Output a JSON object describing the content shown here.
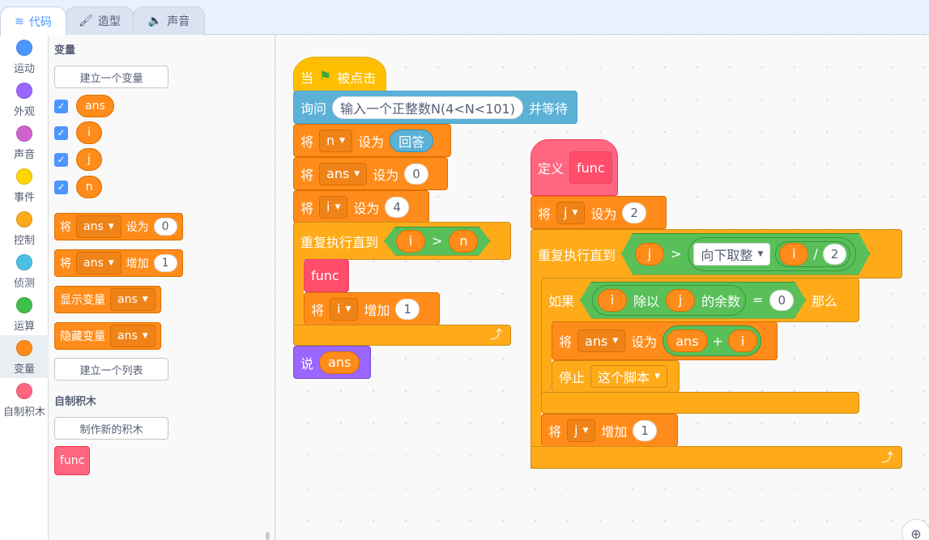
{
  "tabs": [
    {
      "label": "代码",
      "icon": "code-icon"
    },
    {
      "label": "造型",
      "icon": "brush-icon"
    },
    {
      "label": "声音",
      "icon": "speaker-icon"
    }
  ],
  "categories": [
    {
      "label": "运动",
      "color": "#4c97ff"
    },
    {
      "label": "外观",
      "color": "#9966ff"
    },
    {
      "label": "声音",
      "color": "#cf63cf"
    },
    {
      "label": "事件",
      "color": "#ffd500"
    },
    {
      "label": "控制",
      "color": "#ffab19"
    },
    {
      "label": "侦测",
      "color": "#4cbfe6"
    },
    {
      "label": "运算",
      "color": "#40bf4a"
    },
    {
      "label": "变量",
      "color": "#ff8c1a"
    },
    {
      "label": "自制积木",
      "color": "#ff6680"
    }
  ],
  "flyout": {
    "variables_heading": "变量",
    "make_variable": "建立一个变量",
    "variables": [
      "ans",
      "i",
      "j",
      "n"
    ],
    "set_label": "将",
    "set_var": "ans",
    "set_to": "设为",
    "set_value": "0",
    "change_label": "将",
    "change_var": "ans",
    "change_by": "增加",
    "change_value": "1",
    "show_var": "显示变量",
    "show_var_name": "ans",
    "hide_var": "隐藏变量",
    "hide_var_name": "ans",
    "make_list": "建立一个列表",
    "myblocks_heading": "自制积木",
    "make_block": "制作新的积木",
    "custom_block": "func"
  },
  "script1": {
    "when": "当",
    "clicked": "被点击",
    "ask": "询问",
    "ask_text": "输入一个正整数N(4<N<101)",
    "and_wait": "并等待",
    "set1_label": "将",
    "set1_var": "n",
    "set1_to": "设为",
    "set1_value": "回答",
    "set2_label": "将",
    "set2_var": "ans",
    "set2_to": "设为",
    "set2_value": "0",
    "set3_label": "将",
    "set3_var": "i",
    "set3_to": "设为",
    "set3_value": "4",
    "repeat": "重复执行直到",
    "cond_left": "i",
    "cond_op": ">",
    "cond_right": "n",
    "call": "func",
    "chg_label": "将",
    "chg_var": "i",
    "chg_by": "增加",
    "chg_value": "1",
    "say": "说",
    "say_value": "ans"
  },
  "script2": {
    "define": "定义",
    "define_name": "func",
    "set_label": "将",
    "set_var": "j",
    "set_to": "设为",
    "set_value": "2",
    "repeat": "重复执行直到",
    "cond_left": "j",
    "cond_op": ">",
    "floor": "向下取整",
    "div_left": "i",
    "div_op": "/",
    "div_right": "2",
    "if": "如果",
    "mod_left": "i",
    "mod_text": "除以",
    "mod_right": "j",
    "mod_suffix": "的余数",
    "eq": "=",
    "eq_right": "0",
    "then": "那么",
    "set2_label": "将",
    "set2_var": "ans",
    "set2_to": "设为",
    "add_left": "ans",
    "add_op": "+",
    "add_right": "i",
    "stop": "停止",
    "stop_option": "这个脚本",
    "chg_label": "将",
    "chg_var": "j",
    "chg_by": "增加",
    "chg_value": "1"
  }
}
